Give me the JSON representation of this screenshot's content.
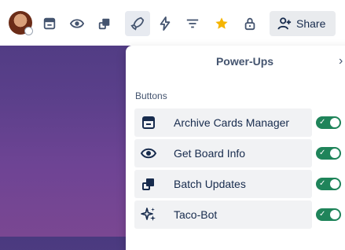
{
  "toolbar": {
    "icons": [
      "archive-icon",
      "eye-icon",
      "batch-icon",
      "rocket-icon",
      "bolt-icon",
      "filter-icon",
      "star-icon",
      "lock-icon"
    ],
    "share_label": "Share",
    "star_color": "#f5b400"
  },
  "panel": {
    "title": "Power-Ups",
    "section_label": "Buttons",
    "items": [
      {
        "label": "Archive Cards Manager",
        "icon": "archive-icon",
        "enabled": true
      },
      {
        "label": "Get Board Info",
        "icon": "eye-icon",
        "enabled": true
      },
      {
        "label": "Batch Updates",
        "icon": "batch-icon",
        "enabled": true
      },
      {
        "label": "Taco-Bot",
        "icon": "sparkles-icon",
        "enabled": true
      }
    ]
  },
  "colors": {
    "toggle_on": "#1f845a",
    "board_bg": "#5a3f8a"
  }
}
